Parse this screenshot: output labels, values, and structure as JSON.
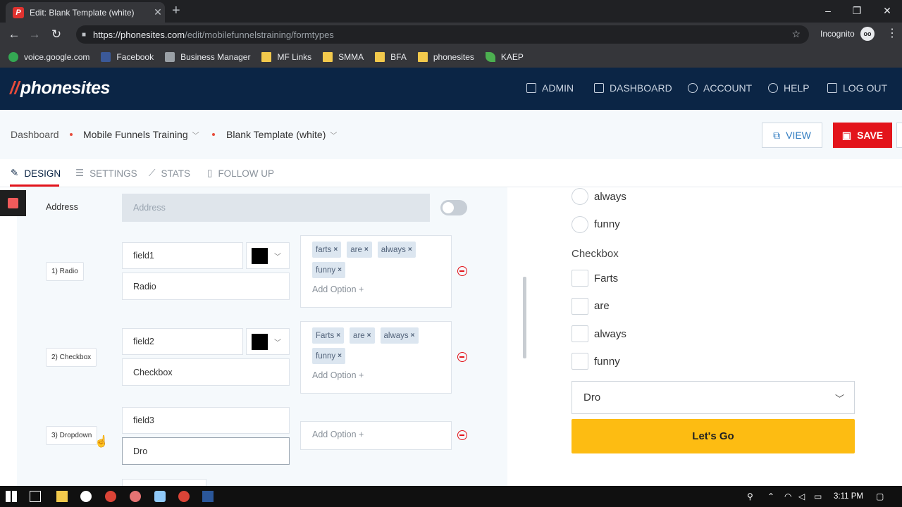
{
  "browser": {
    "tab_title": "Edit: Blank Template (white)",
    "tab_close": "✕",
    "new_tab": "+",
    "url_host": "https://phonesites.com",
    "url_path": "/edit/mobilefunnelstraining/formtypes",
    "incognito_label": "Incognito",
    "window_controls": [
      "–",
      "❐",
      "✕"
    ],
    "bookmarks": [
      {
        "label": "voice.google.com",
        "icon": "google-voice-icon"
      },
      {
        "label": "Facebook",
        "icon": "facebook-icon"
      },
      {
        "label": "Business Manager",
        "icon": "briefcase-icon"
      },
      {
        "label": "MF Links",
        "icon": "folder-icon"
      },
      {
        "label": "SMMA",
        "icon": "folder-icon"
      },
      {
        "label": "BFA",
        "icon": "folder-icon"
      },
      {
        "label": "phonesites",
        "icon": "folder-icon"
      },
      {
        "label": "KAEP",
        "icon": "leaf-icon"
      }
    ]
  },
  "header": {
    "logo": "phonesites",
    "nav": [
      "ADMIN",
      "DASHBOARD",
      "ACCOUNT",
      "HELP",
      "LOG OUT"
    ]
  },
  "breadcrumb": {
    "home": "Dashboard",
    "project": "Mobile Funnels Training",
    "page": "Blank Template (white)"
  },
  "actions": {
    "view": "VIEW",
    "save": "SAVE"
  },
  "tabs": [
    "DESIGN",
    "SETTINGS",
    "STATS",
    "FOLLOW UP"
  ],
  "form_editor": {
    "address_label": "Address",
    "address_placeholder": "Address",
    "rows": [
      {
        "tag": "1) Radio",
        "field_name": "field1",
        "field_label": "Radio",
        "options": [
          "farts",
          "are",
          "always",
          "funny"
        ],
        "add_option": "Add Option +"
      },
      {
        "tag": "2) Checkbox",
        "field_name": "field2",
        "field_label": "Checkbox",
        "options": [
          "Farts",
          "are",
          "always",
          "funny"
        ],
        "add_option": "Add Option +"
      },
      {
        "tag": "3) Dropdown",
        "field_name": "field3",
        "field_label": "Dro",
        "options": [],
        "add_option": "Add Option +"
      }
    ]
  },
  "preview": {
    "radio_options": [
      "always",
      "funny"
    ],
    "checkbox_heading": "Checkbox",
    "checkbox_options": [
      "Farts",
      "are",
      "always",
      "funny"
    ],
    "dropdown_value": "Dro",
    "submit": "Let's Go"
  },
  "taskbar": {
    "time": "3:11 PM"
  },
  "colors": {
    "brand_navy": "#0b2545",
    "save_red": "#e3141b",
    "cta_yellow": "#fdbc12"
  }
}
